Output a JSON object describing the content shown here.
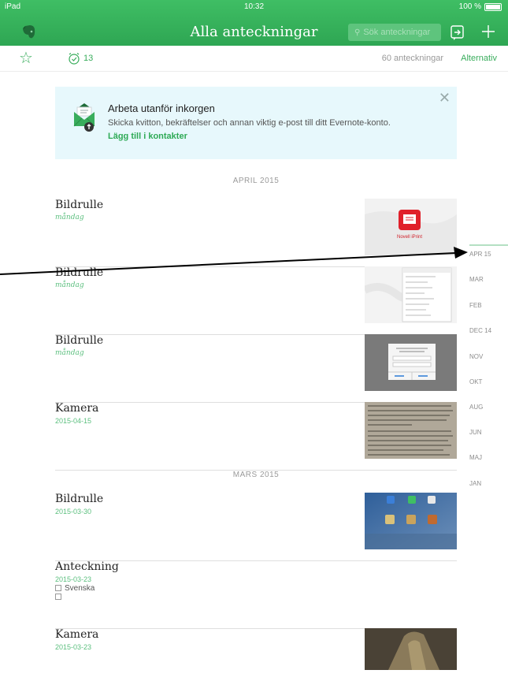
{
  "status_bar": {
    "carrier": "iPad",
    "time": "10:32",
    "battery": "100 %"
  },
  "header": {
    "title": "Alla anteckningar",
    "search_placeholder": "Sök anteckningar"
  },
  "subbar": {
    "reminder_count": "13",
    "note_count": "60 anteckningar",
    "options_label": "Alternativ"
  },
  "banner": {
    "title": "Arbeta utanför inkorgen",
    "text": "Skicka kvitton, bekräftelser och annan viktig e-post till ditt Evernote-konto.",
    "link": "Lägg till i kontakter"
  },
  "sections": [
    {
      "label": "APRIL 2015"
    },
    {
      "label": "MARS 2015"
    }
  ],
  "notes": [
    {
      "title": "Bildrulle",
      "date": "måndag",
      "thumb": "noveli-iprint"
    },
    {
      "title": "Bildrulle",
      "date": "måndag",
      "thumb": "screenshot-list"
    },
    {
      "title": "Bildrulle",
      "date": "måndag",
      "thumb": "dialog-screenshot"
    },
    {
      "title": "Kamera",
      "date": "2015-04-15",
      "thumb": "book-page-photo"
    },
    {
      "title": "Bildrulle",
      "date": "2015-03-30",
      "thumb": "ipad-homescreen"
    },
    {
      "title": "Anteckning",
      "date": "2015-03-23",
      "lines": [
        "Svenska",
        ""
      ]
    },
    {
      "title": "Kamera",
      "date": "2015-03-23",
      "thumb": "dark-photo"
    }
  ],
  "date_index": [
    "APR 15",
    "MAR",
    "FEB",
    "DEC 14",
    "NOV",
    "OKT",
    "AUG",
    "JUN",
    "MAJ",
    "JAN"
  ],
  "thumb_texts": {
    "noveli_label": "Novell iPrint"
  },
  "colors": {
    "accent": "#2eaa55",
    "header": "#33ad5b",
    "banner_bg": "#e7f8fc"
  }
}
